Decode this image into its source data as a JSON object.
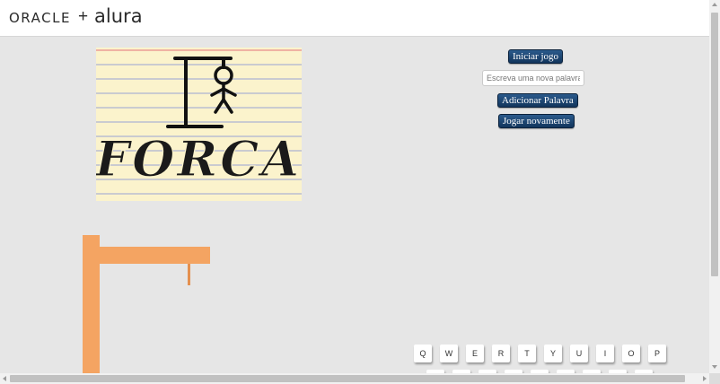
{
  "header": {
    "logo_oracle": "ORACLE",
    "logo_plus": "+",
    "logo_alura": "alura"
  },
  "banner": {
    "title": "FORCA"
  },
  "controls": {
    "start_label": "Iniciar jogo",
    "new_word_placeholder": "Escreva uma nova palavra",
    "add_word_label": "Adicionar Palavra",
    "play_again_label": "Jogar novamente"
  },
  "keyboard": {
    "row1": [
      "Q",
      "W",
      "E",
      "R",
      "T",
      "Y",
      "U",
      "I",
      "O",
      "P"
    ]
  },
  "colors": {
    "gallows": "#f4a462",
    "button": "#1b4470",
    "background": "#e6e6e6"
  }
}
